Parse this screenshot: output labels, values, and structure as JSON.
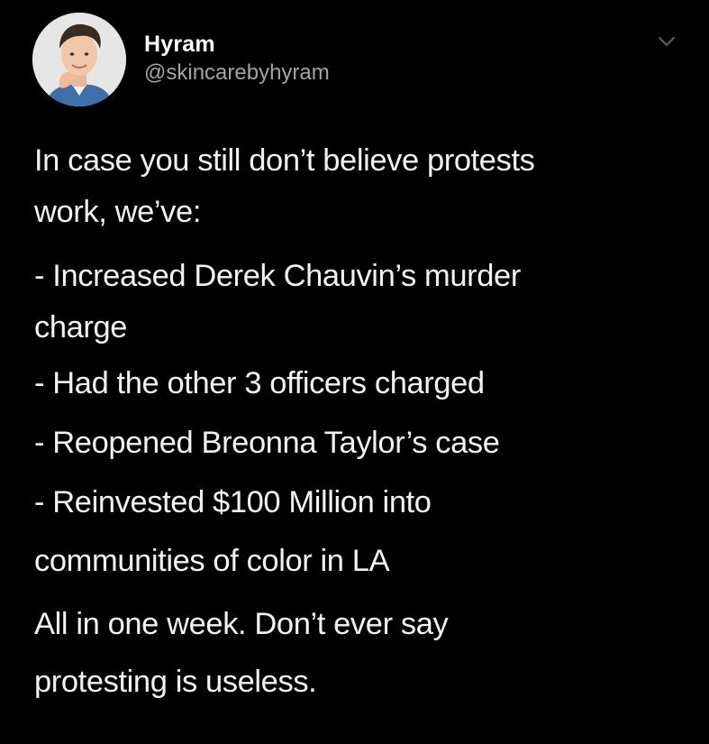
{
  "user": {
    "display_name": "Hyram",
    "handle": "@skincarebyhyram",
    "avatar_icon": "profile-photo"
  },
  "menu": {
    "icon": "chevron-down-icon"
  },
  "tweet": {
    "intro_lines": [
      "In case you still don’t believe protests",
      "work, we’ve:"
    ],
    "list_lines": [
      "- Increased Derek Chauvin’s murder",
      "charge",
      "- Had the other 3 officers charged",
      "- Reopened Breonna Taylor’s case",
      "- Reinvested $100 Million into",
      "communities of color in LA"
    ],
    "closing_lines": [
      "All in one week. Don’t ever say",
      "protesting is useless."
    ]
  },
  "colors": {
    "background": "#000000",
    "text": "#f2f2f2",
    "handle": "#a3a3a3"
  }
}
